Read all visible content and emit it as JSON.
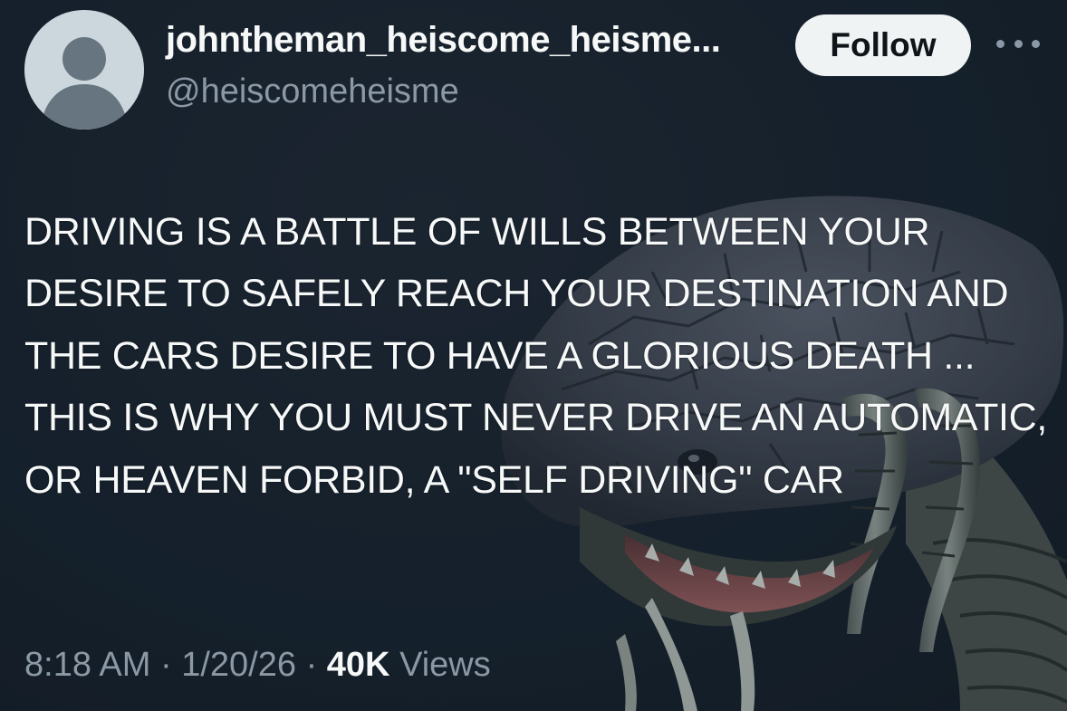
{
  "author": {
    "display_name": "johntheman_heiscome_heisme...",
    "handle": "@heiscomeheisme",
    "avatar_icon": "default-avatar-icon"
  },
  "actions": {
    "follow_label": "Follow",
    "more_icon": "more-dots-icon"
  },
  "tweet": {
    "text": "DRIVING IS A BATTLE OF WILLS BETWEEN YOUR DESIRE TO SAFELY REACH YOUR DESTINATION AND THE CARS DESIRE TO HAVE A GLORIOUS DEATH ... THIS IS WHY YOU MUST NEVER DRIVE AN AUTOMATIC, OR HEAVEN FORBID, A \"SELF DRIVING\" CAR"
  },
  "meta": {
    "time": "8:18 AM",
    "separator": "·",
    "date": "1/20/26",
    "views_count": "40K",
    "views_label": "Views"
  },
  "colors": {
    "background": "#15202b",
    "text_primary": "#f7f9f9",
    "text_secondary": "#8b98a5",
    "follow_button_bg": "#eff3f4"
  }
}
